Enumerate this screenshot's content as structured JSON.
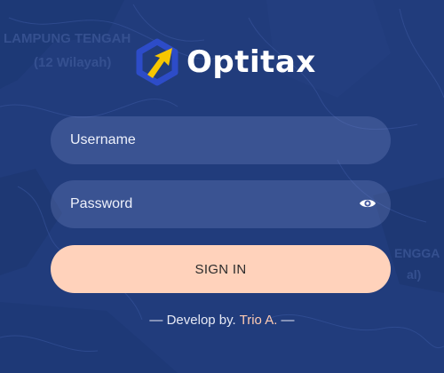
{
  "brand": {
    "name": "Optitax",
    "logo_icon": "hexagon-arrow-logo",
    "colors": {
      "hexagon": "#2d4cc8",
      "arrow": "#f7c600"
    }
  },
  "background": {
    "icon": "region-map-background",
    "labels": [
      "LAMPUNG TENGAH",
      "(12 Wilayah)",
      "ENGGA",
      "al)"
    ]
  },
  "form": {
    "username": {
      "placeholder": "Username",
      "value": ""
    },
    "password": {
      "placeholder": "Password",
      "value": "",
      "toggle_icon": "eye-icon"
    },
    "submit_label": "SIGN IN"
  },
  "footer": {
    "prefix": "— Develop by. ",
    "author": "Trio A.",
    "suffix": " —"
  },
  "colors": {
    "page_background": "#1f3a78",
    "input_background": "#4d62a6",
    "button_background": "#ffd2bb",
    "footer_author": "#ffcbb2"
  }
}
